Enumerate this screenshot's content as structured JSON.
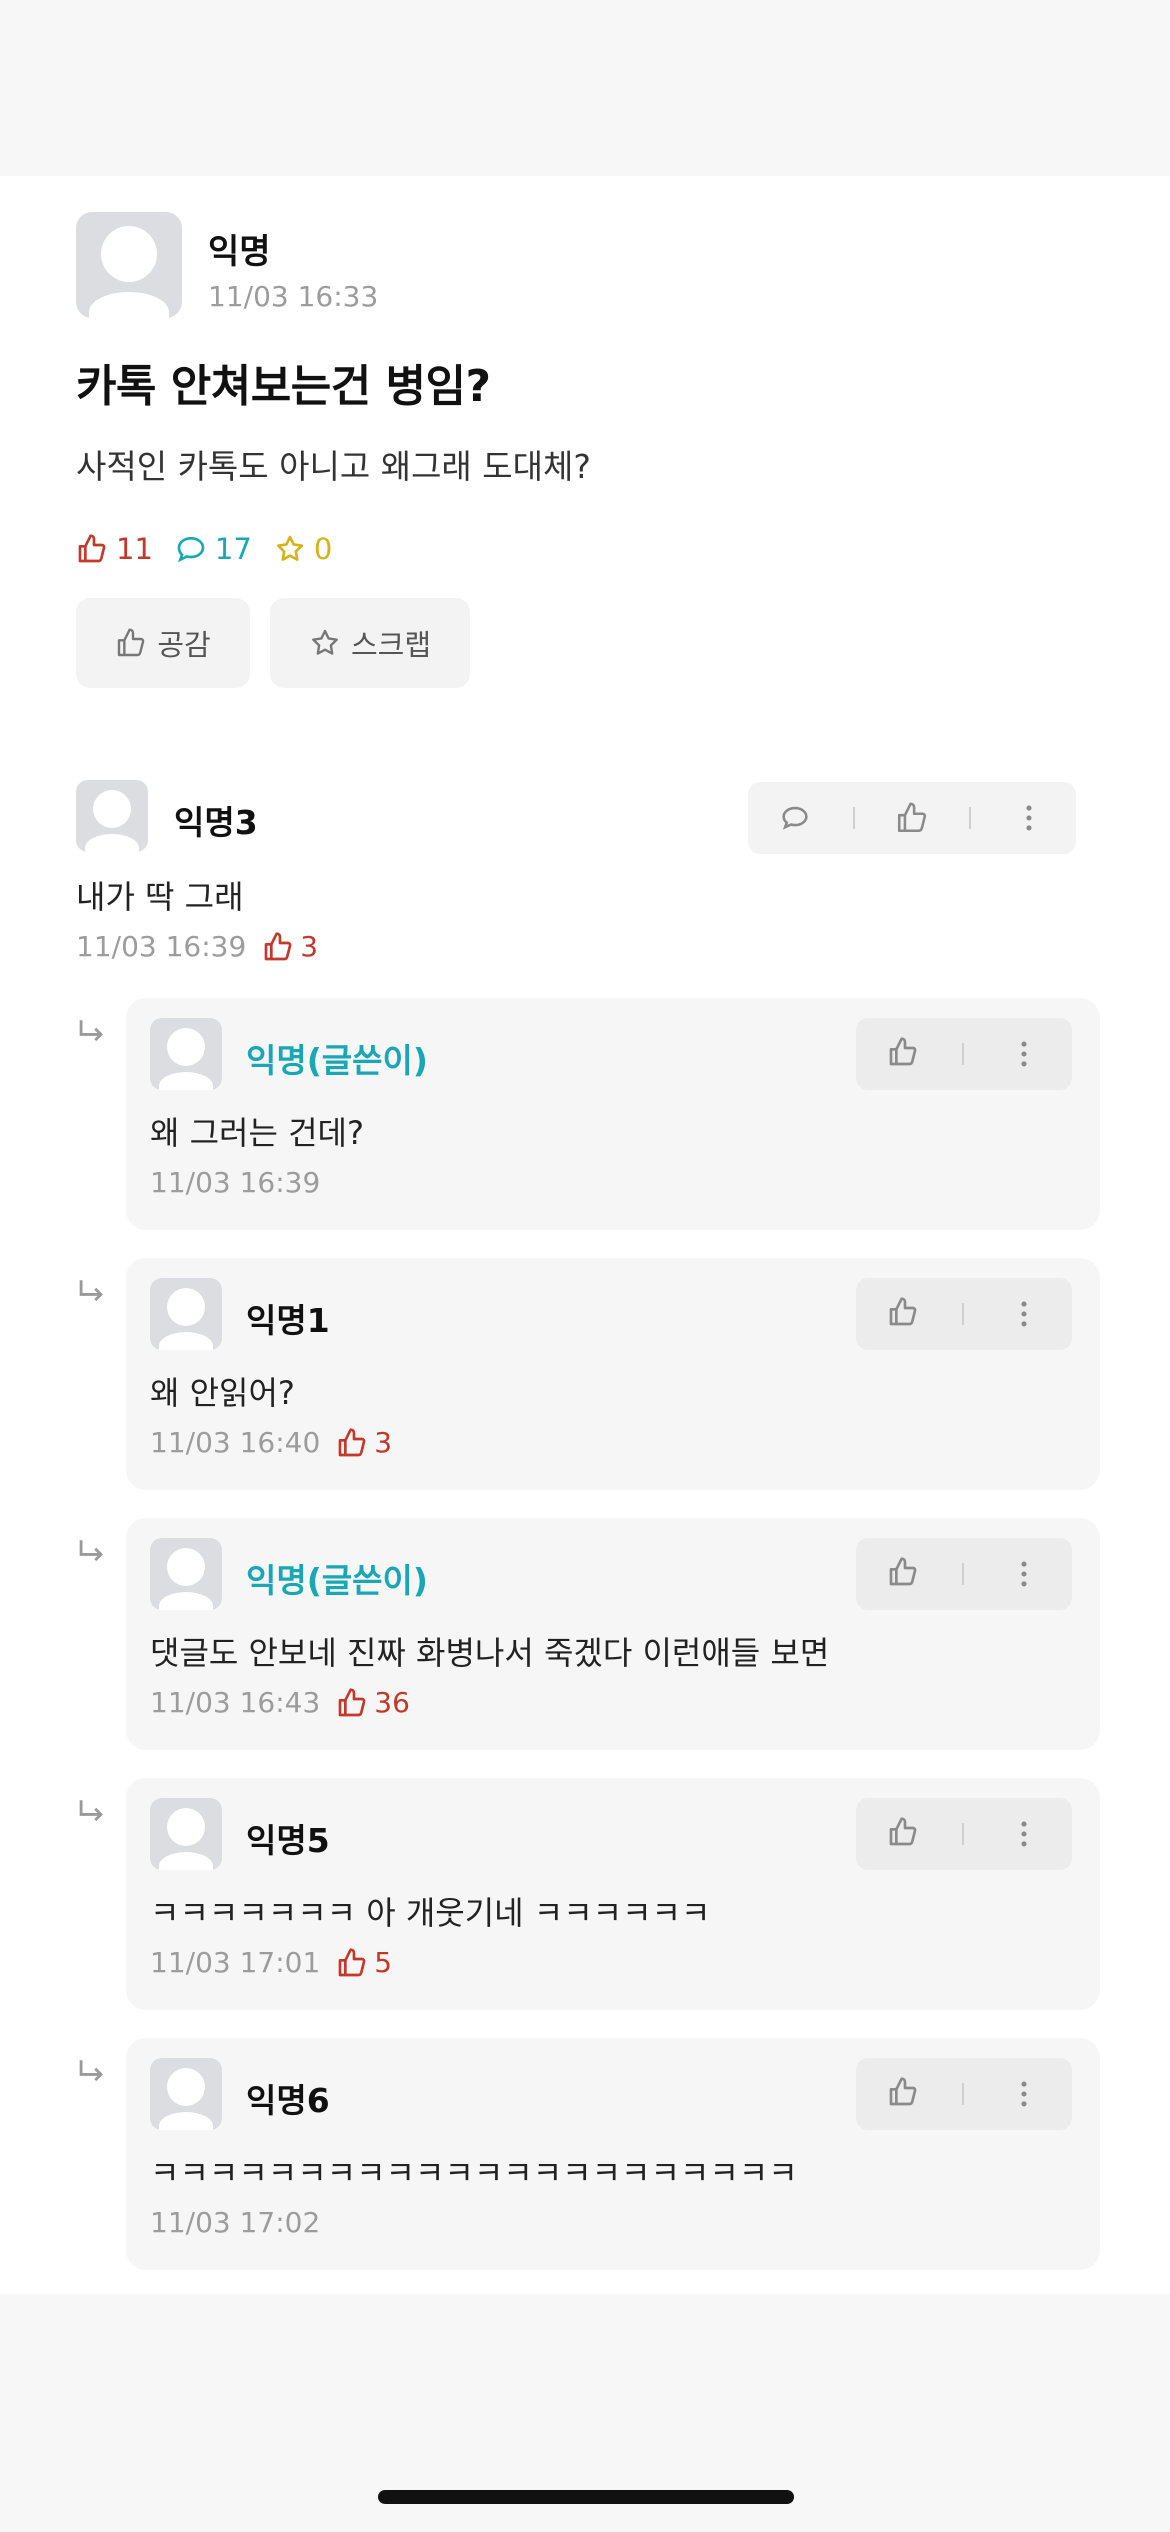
{
  "post": {
    "author": "익명",
    "time": "11/03 16:33",
    "title": "카톡 안쳐보는건 병임?",
    "body": "사적인 카톡도 아니고 왜그래 도대체?",
    "likes": "11",
    "comments": "17",
    "scraps": "0",
    "like_button": "공감",
    "scrap_button": "스크랩"
  },
  "comment": {
    "author": "익명3",
    "text": "내가 딱 그래",
    "time": "11/03 16:39",
    "likes": "3"
  },
  "replies": [
    {
      "author": "익명(글쓴이)",
      "is_op": true,
      "text": "왜 그러는 건데?",
      "time": "11/03 16:39",
      "likes": ""
    },
    {
      "author": "익명1",
      "is_op": false,
      "text": "왜 안읽어?",
      "time": "11/03 16:40",
      "likes": "3"
    },
    {
      "author": "익명(글쓴이)",
      "is_op": true,
      "text": "댓글도 안보네 진짜 화병나서 죽겠다 이런애들 보면",
      "time": "11/03 16:43",
      "likes": "36"
    },
    {
      "author": "익명5",
      "is_op": false,
      "text": "ㅋㅋㅋㅋㅋㅋㅋ 아 개웃기네 ㅋㅋㅋㅋㅋㅋ",
      "time": "11/03 17:01",
      "likes": "5"
    },
    {
      "author": "익명6",
      "is_op": false,
      "text": "ㅋㅋㅋㅋㅋㅋㅋㅋㅋㅋㅋㅋㅋㅋㅋㅋㅋㅋㅋㅋㅋㅋ",
      "time": "11/03 17:02",
      "likes": ""
    }
  ],
  "colors": {
    "like": "#c0392b",
    "comment": "#19a7b5",
    "scrap": "#d6b31a",
    "op_name": "#19a7b5"
  },
  "icons": {
    "like": "thumbs-up-icon",
    "comment": "speech-bubble-icon",
    "scrap": "star-icon",
    "more": "more-vertical-icon",
    "reply": "reply-arrow-icon"
  }
}
